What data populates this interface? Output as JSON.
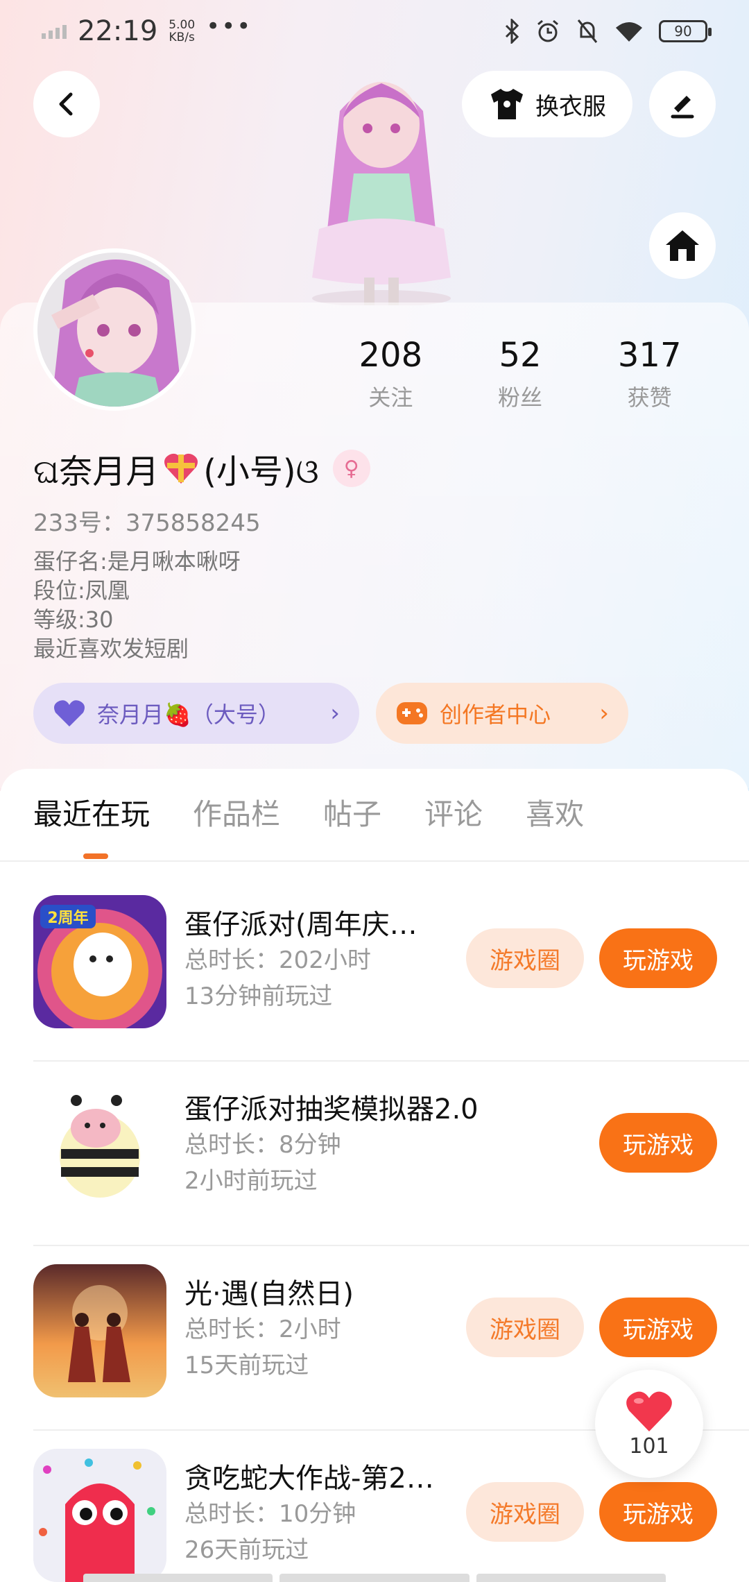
{
  "status_bar": {
    "time": "22:19",
    "speed_value": "5.00",
    "speed_unit": "KB/s",
    "more": "•••",
    "battery": "90"
  },
  "header": {
    "dress_up_label": "换衣服"
  },
  "profile": {
    "stats": [
      {
        "value": "208",
        "label": "关注"
      },
      {
        "value": "52",
        "label": "粉丝"
      },
      {
        "value": "317",
        "label": "获赞"
      }
    ],
    "nickname_prefix": "ଘ奈月月",
    "nickname_suffix": "(小号)ଓ",
    "gender_symbol": "♀",
    "uid": "233号：375858245",
    "bio_lines": [
      "蛋仔名:是月啾本啾呀",
      "段位:凤凰",
      "等级:30",
      "最近喜欢发短剧"
    ],
    "linked_account_label": "奈月月🍓（大号）",
    "creator_center_label": "创作者中心"
  },
  "tabs": [
    {
      "label": "最近在玩",
      "active": true
    },
    {
      "label": "作品栏",
      "active": false
    },
    {
      "label": "帖子",
      "active": false
    },
    {
      "label": "评论",
      "active": false
    },
    {
      "label": "喜欢",
      "active": false
    }
  ],
  "games": [
    {
      "title": "蛋仔派对(周年庆…",
      "duration": "总时长：202小时",
      "last_played": "13分钟前玩过",
      "has_circle": true
    },
    {
      "title": "蛋仔派对抽奖模拟器2.0",
      "duration": "总时长：8分钟",
      "last_played": "2小时前玩过",
      "has_circle": false
    },
    {
      "title": "光·遇(自然日)",
      "duration": "总时长：2小时",
      "last_played": "15天前玩过",
      "has_circle": true
    },
    {
      "title": "贪吃蛇大作战-第2…",
      "duration": "总时长：10分钟",
      "last_played": "26天前玩过",
      "has_circle": true
    }
  ],
  "buttons": {
    "game_circle": "游戏圈",
    "play": "玩游戏"
  },
  "float_like": {
    "count": "101"
  },
  "colors": {
    "accent": "#f97216",
    "accent_light": "#fde7da",
    "purple_pill": "#e6e0f7"
  }
}
